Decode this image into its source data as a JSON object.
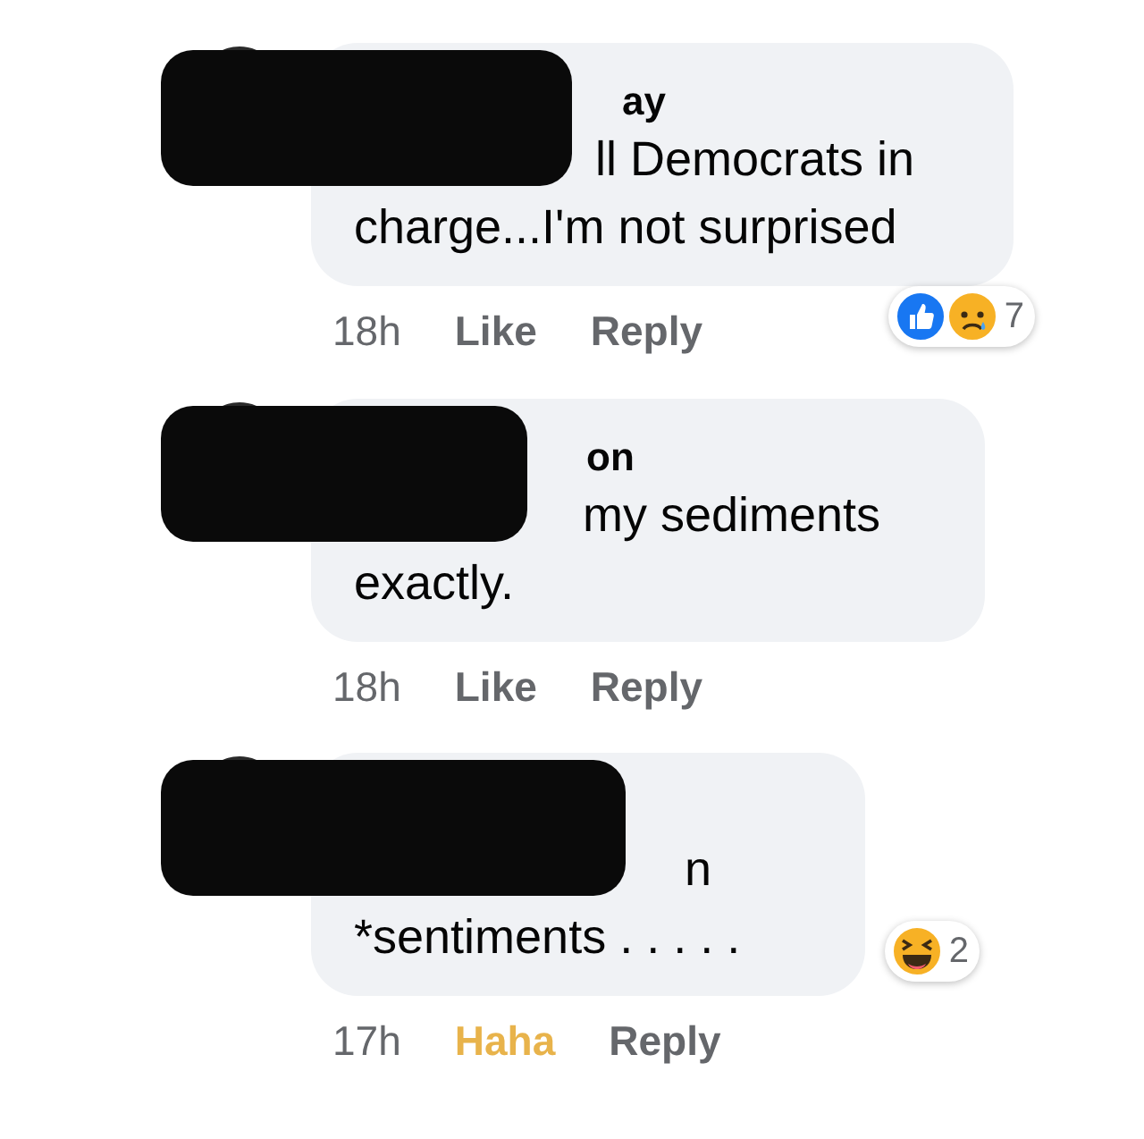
{
  "comments": [
    {
      "redacted": true,
      "name": "ay",
      "body": "ll Democrats in\ncharge...I'm not surprised",
      "time": "18h",
      "actions": [
        {
          "label": "Like",
          "selected": false
        },
        {
          "label": "Reply",
          "selected": false
        }
      ],
      "reactions": {
        "items": [
          {
            "kind": "like"
          },
          {
            "kind": "sad"
          }
        ],
        "count": "7"
      }
    },
    {
      "redacted": true,
      "name": "on",
      "body": "my sediments\nexactly.",
      "time": "18h",
      "actions": [
        {
          "label": "Like",
          "selected": false
        },
        {
          "label": "Reply",
          "selected": false
        }
      ]
    },
    {
      "redacted": true,
      "body": "n\n*sentiments . . . . .",
      "time": "17h",
      "actions": [
        {
          "label": "Haha",
          "selected": true
        },
        {
          "label": "Reply",
          "selected": false
        }
      ],
      "reactions": {
        "items": [
          {
            "kind": "haha"
          }
        ],
        "count": "2"
      }
    }
  ]
}
